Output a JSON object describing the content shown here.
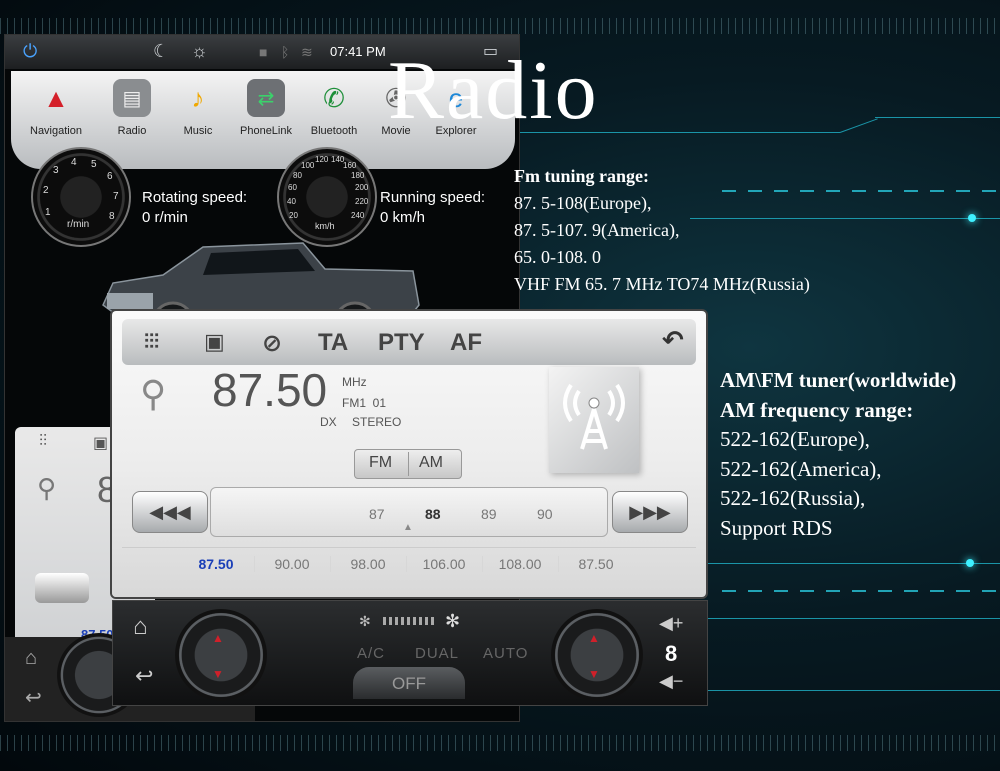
{
  "status_bar": {
    "time": "07:41 PM"
  },
  "apps": [
    {
      "label": "Navigation",
      "icon": "navigation-icon"
    },
    {
      "label": "Radio",
      "icon": "radio-icon"
    },
    {
      "label": "Music",
      "icon": "music-icon"
    },
    {
      "label": "PhoneLink",
      "icon": "phonelink-icon"
    },
    {
      "label": "Bluetooth",
      "icon": "bluetooth-phone-icon"
    },
    {
      "label": "Movie",
      "icon": "movie-icon"
    },
    {
      "label": "Explorer",
      "icon": "explorer-icon"
    }
  ],
  "gauges": {
    "rpm": {
      "unit": "r/min",
      "label": "Rotating speed:",
      "value": "0 r/min",
      "ticks": [
        "1",
        "2",
        "3",
        "4",
        "5",
        "6",
        "7",
        "8"
      ]
    },
    "speed": {
      "unit": "km/h",
      "label": "Running speed:",
      "value": "0 km/h",
      "ticks": [
        "20",
        "40",
        "60",
        "80",
        "100",
        "120",
        "140",
        "160",
        "180",
        "200",
        "220",
        "240"
      ]
    }
  },
  "radio": {
    "toolbar": {
      "ta": "TA",
      "pty": "PTY",
      "af": "AF"
    },
    "frequency": "87.50",
    "unit": "MHz",
    "band_preset": "FM1  01",
    "dx": "DX",
    "stereo": "STEREO",
    "bands": [
      "FM",
      "AM"
    ],
    "scale": [
      "87",
      "88",
      "89",
      "90"
    ],
    "scale_active": "88",
    "presets": [
      "87.50",
      "90.00",
      "98.00",
      "106.00",
      "108.00",
      "87.50"
    ],
    "ghost_freq": "8",
    "ghost_preset": "87.50"
  },
  "climate": {
    "ac": "A/C",
    "dual": "DUAL",
    "auto": "AUTO",
    "off": "OFF",
    "volume": "8"
  },
  "headline": "Radio",
  "fm_spec": [
    "Fm tuning range:",
    "87. 5-108(Europe),",
    "87. 5-107. 9(America),",
    "65. 0-108. 0",
    "VHF FM 65. 7 MHz TO74 MHz(Russia)"
  ],
  "am_spec": [
    "AM\\FM tuner(worldwide)",
    "AM frequency range:",
    "522-162(Europe),",
    "522-162(America),",
    "522-162(Russia),",
    "Support RDS"
  ],
  "colors": {
    "accent": "#2ad1e6",
    "active_preset": "#1a3fb8",
    "background": "#071a22"
  }
}
